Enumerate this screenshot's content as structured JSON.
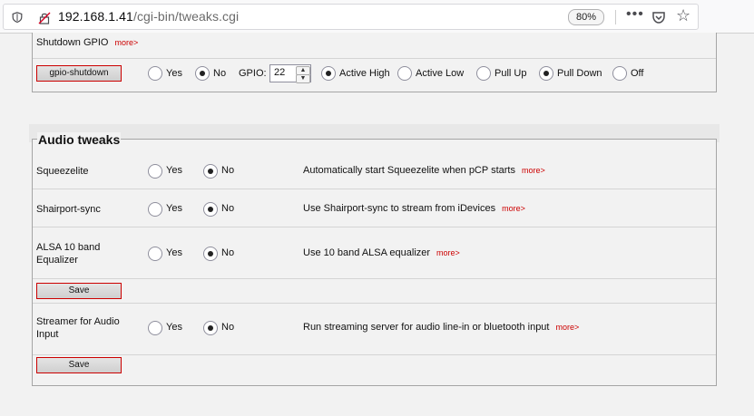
{
  "browser": {
    "url_host": "192.168.1.41",
    "url_path": "/cgi-bin/tweaks.cgi",
    "zoom": "80%",
    "menu_label": "•••"
  },
  "shutdown": {
    "label": "Shutdown GPIO",
    "more": "more>",
    "button": "gpio-shutdown",
    "yes": "Yes",
    "no": "No",
    "gpio_label": "GPIO:",
    "gpio_value": "22",
    "active_high": "Active High",
    "active_low": "Active Low",
    "pull_up": "Pull Up",
    "pull_down": "Pull Down",
    "off": "Off"
  },
  "audio": {
    "legend": "Audio tweaks",
    "rows": [
      {
        "label": "Squeezelite",
        "yes": "Yes",
        "no": "No",
        "desc": "Automatically start Squeezelite when pCP starts",
        "more": "more>"
      },
      {
        "label": "Shairport-sync",
        "yes": "Yes",
        "no": "No",
        "desc": "Use Shairport-sync to stream from iDevices",
        "more": "more>"
      },
      {
        "label": "ALSA 10 band Equalizer",
        "yes": "Yes",
        "no": "No",
        "desc": "Use 10 band ALSA equalizer",
        "more": "more>"
      },
      {
        "label": "Streamer for Audio Input",
        "yes": "Yes",
        "no": "No",
        "desc": "Run streaming server for audio line-in or bluetooth input",
        "more": "more>"
      }
    ],
    "save_label": "Save"
  }
}
